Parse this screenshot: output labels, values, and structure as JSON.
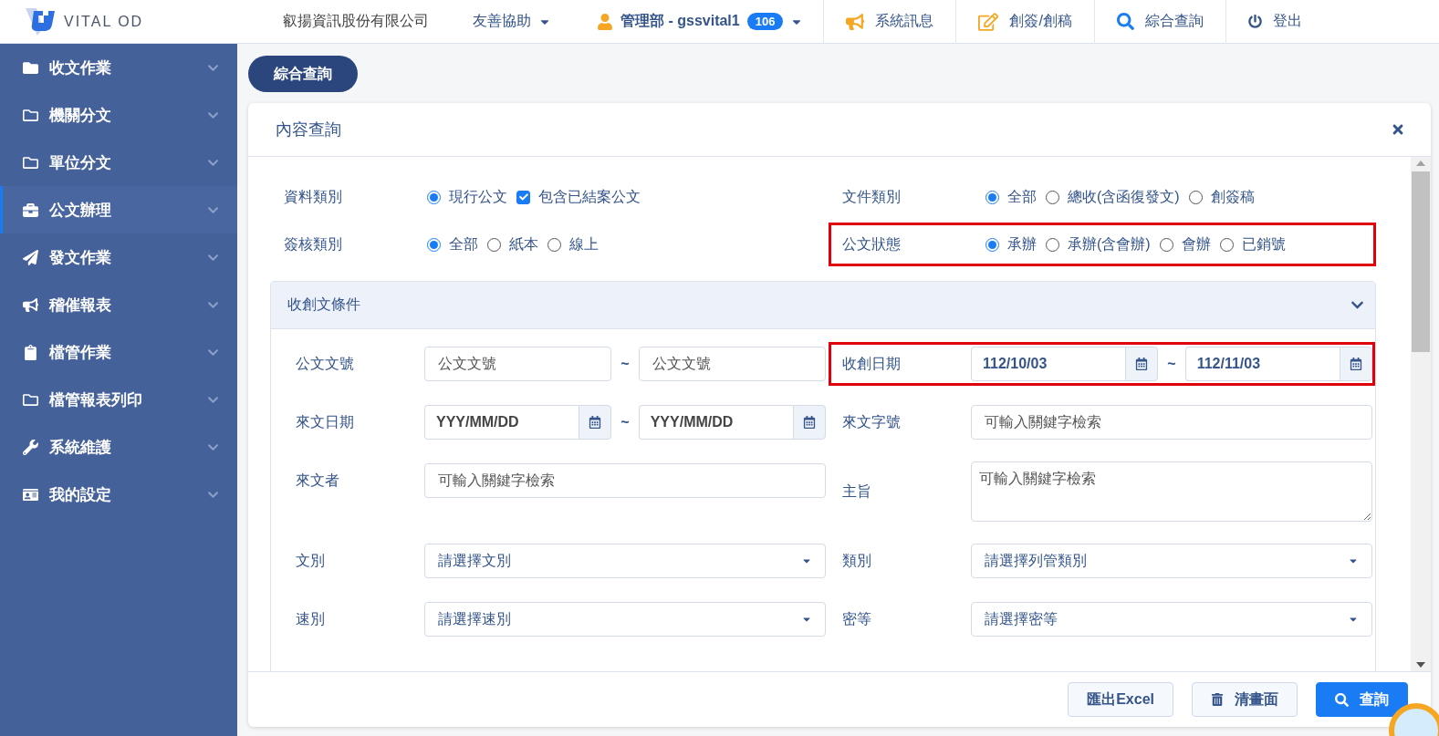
{
  "header": {
    "logo_text": "VITAL OD",
    "company": "叡揚資訊股份有限公司",
    "help_menu": "友善協助",
    "user": "管理部 - gssvital1",
    "user_badge": "106",
    "actions": [
      {
        "kind": "message",
        "label": "系統訊息"
      },
      {
        "kind": "compose",
        "label": "創簽/創稿"
      },
      {
        "kind": "search",
        "label": "綜合查詢"
      },
      {
        "kind": "logout",
        "label": "登出"
      }
    ]
  },
  "sidebar": {
    "items": [
      {
        "label": "收文作業",
        "selected": false
      },
      {
        "label": "機關分文",
        "selected": false
      },
      {
        "label": "單位分文",
        "selected": false
      },
      {
        "label": "公文辦理",
        "selected": true
      },
      {
        "label": "發文作業",
        "selected": false
      },
      {
        "label": "稽催報表",
        "selected": false
      },
      {
        "label": "檔管作業",
        "selected": false
      },
      {
        "label": "檔管報表列印",
        "selected": false
      },
      {
        "label": "系統維護",
        "selected": false
      },
      {
        "label": "我的設定",
        "selected": false
      }
    ]
  },
  "page_tabs": [
    {
      "label": "綜合查詢",
      "selected": true
    }
  ],
  "panel": {
    "title": "內容查詢",
    "top_filters": [
      {
        "label": "資料類別",
        "highlighted": false,
        "options": [
          {
            "kind": "radio",
            "label": "現行公文",
            "selected": true
          },
          {
            "kind": "checkbox",
            "label": "包含已結案公文",
            "checked": true
          }
        ]
      },
      {
        "label": "文件類別",
        "highlighted": false,
        "options": [
          {
            "kind": "radio",
            "label": "全部",
            "selected": true
          },
          {
            "kind": "radio",
            "label": "總收(含函復發文)",
            "selected": false
          },
          {
            "kind": "radio",
            "label": "創簽稿",
            "selected": false
          }
        ]
      },
      {
        "label": "簽核類別",
        "highlighted": false,
        "options": [
          {
            "kind": "radio",
            "label": "全部",
            "selected": true
          },
          {
            "kind": "radio",
            "label": "紙本",
            "selected": false
          },
          {
            "kind": "radio",
            "label": "線上",
            "selected": false
          }
        ]
      },
      {
        "label": "公文狀態",
        "highlighted": true,
        "options": [
          {
            "kind": "radio",
            "label": "承辦",
            "selected": true
          },
          {
            "kind": "radio",
            "label": "承辦(含會辦)",
            "selected": false
          },
          {
            "kind": "radio",
            "label": "會辦",
            "selected": false
          },
          {
            "kind": "radio",
            "label": "已銷號",
            "selected": false
          }
        ]
      }
    ],
    "section": {
      "title": "收創文條件",
      "expanded": true,
      "fields": [
        {
          "kind": "text_range",
          "label": "公文文號",
          "highlighted": false,
          "from": {
            "placeholder": "公文文號"
          },
          "separator": "~",
          "to": {
            "placeholder": "公文文號"
          }
        },
        {
          "kind": "date_range",
          "label": "收創日期",
          "highlighted": true,
          "from": {
            "value": "112/10/03"
          },
          "separator": "~",
          "to": {
            "value": "112/11/03"
          }
        },
        {
          "kind": "date_range",
          "label": "來文日期",
          "highlighted": false,
          "from": {
            "placeholder": "YYY/MM/DD"
          },
          "separator": "~",
          "to": {
            "placeholder": "YYY/MM/DD"
          }
        },
        {
          "kind": "text",
          "label": "來文字號",
          "highlighted": false,
          "placeholder": "可輸入關鍵字檢索"
        },
        {
          "kind": "text",
          "label": "來文者",
          "highlighted": false,
          "placeholder": "可輸入關鍵字檢索"
        },
        {
          "kind": "textarea",
          "label": "主旨",
          "highlighted": false,
          "placeholder": "可輸入關鍵字檢索"
        },
        {
          "kind": "select",
          "label": "文別",
          "highlighted": false,
          "placeholder": "請選擇文別"
        },
        {
          "kind": "select",
          "label": "類別",
          "highlighted": false,
          "placeholder": "請選擇列管類別"
        },
        {
          "kind": "select",
          "label": "速別",
          "highlighted": false,
          "placeholder": "請選擇速別"
        },
        {
          "kind": "select",
          "label": "密等",
          "highlighted": false,
          "placeholder": "請選擇密等"
        }
      ]
    },
    "buttons": [
      {
        "kind": "export",
        "label": "匯出Excel"
      },
      {
        "kind": "clear",
        "label": "清畫面"
      },
      {
        "kind": "search",
        "label": "查詢"
      }
    ]
  }
}
